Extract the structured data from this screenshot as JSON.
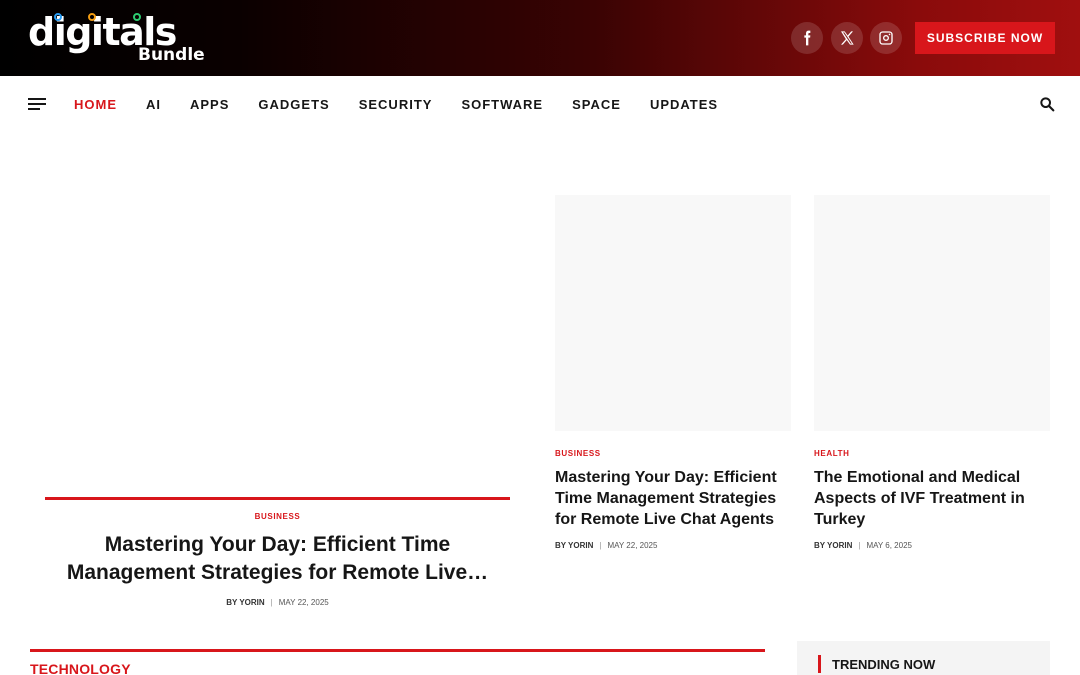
{
  "header": {
    "logo_main": "digitals",
    "logo_sub": "Bundle",
    "social_icons": [
      "facebook-icon",
      "x-icon",
      "instagram-icon"
    ],
    "subscribe_label": "SUBSCRIBE NOW",
    "accent_color": "#d8161b"
  },
  "nav": {
    "items": [
      {
        "label": "HOME",
        "active": true
      },
      {
        "label": "AI"
      },
      {
        "label": "APPS"
      },
      {
        "label": "GADGETS"
      },
      {
        "label": "SECURITY"
      },
      {
        "label": "SOFTWARE"
      },
      {
        "label": "SPACE"
      },
      {
        "label": "UPDATES"
      }
    ],
    "menu_icon": "hamburger-icon",
    "search_icon": "search-icon"
  },
  "featured": {
    "category": "BUSINESS",
    "title": "Mastering Your Day: Efficient Time Management Strategies for Remote Live…",
    "author": "BY YORIN",
    "date": "MAY 22, 2025"
  },
  "cards": [
    {
      "category": "BUSINESS",
      "title": "Mastering Your Day: Efficient Time Management Strategies for Remote Live Chat Agents",
      "author": "BY YORIN",
      "date": "MAY 22, 2025"
    },
    {
      "category": "HEALTH",
      "title": "The Emotional and Medical Aspects of IVF Treatment in Turkey",
      "author": "BY YORIN",
      "date": "MAY 6, 2025"
    }
  ],
  "sections": {
    "technology_label": "TECHNOLOGY",
    "trending_label": "TRENDING NOW"
  }
}
